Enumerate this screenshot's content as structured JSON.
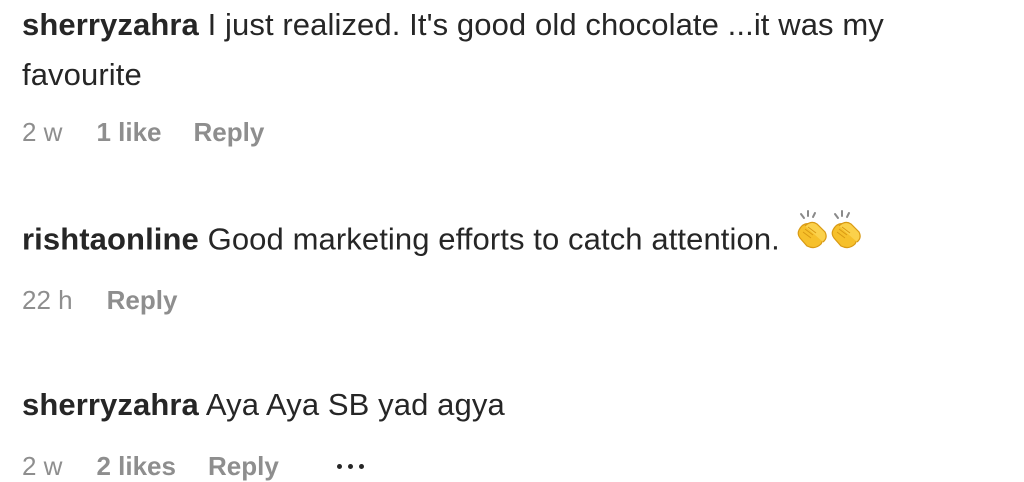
{
  "comments": [
    {
      "username": "sherryzahra",
      "text": " I just realized. It's good old chocolate ...it was my favourite",
      "time": "2 w",
      "likes": "1 like",
      "reply": "Reply"
    },
    {
      "username": "rishtaonline",
      "text": " Good marketing efforts to catch attention. ",
      "emoji": "clapping-hands-icon",
      "time": "22 h",
      "reply": "Reply"
    },
    {
      "username": "sherryzahra",
      "text": " Aya Aya SB yad agya",
      "time": "2 w",
      "likes": "2 likes",
      "reply": "Reply",
      "more_icon": "more-options-icon"
    }
  ],
  "colors": {
    "text": "#262626",
    "secondary": "#8e8e8e",
    "emoji": "#f6c02b"
  }
}
